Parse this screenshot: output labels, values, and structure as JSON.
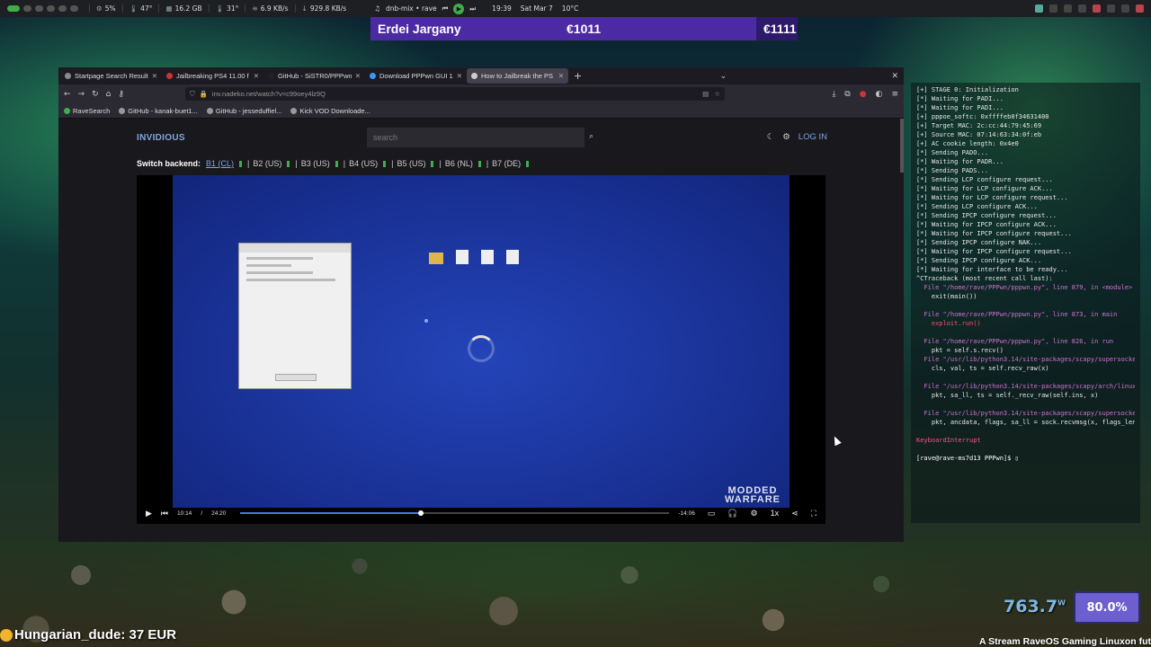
{
  "topbar": {
    "cpu": "5%",
    "temp1": "47°",
    "ram": "16.2 GB",
    "temp2": "31°",
    "net_up": "6.9 KB/s",
    "net_down": "929.8 KB/s",
    "media_title": "dnb-mix • rave",
    "time": "19:39",
    "date": "Sat Mar 7",
    "weather": "10°C"
  },
  "banner": {
    "name": "Erdei Jargany",
    "amount1": "€1011",
    "amount2": "€1111"
  },
  "browser": {
    "tabs": [
      {
        "label": "Startpage Search Result"
      },
      {
        "label": "Jailbreaking PS4 11.00 f"
      },
      {
        "label": "GitHub - SiSTR0/PPPwn"
      },
      {
        "label": "Download PPPwn GUI 1"
      },
      {
        "label": "How to Jailbreak the PS"
      }
    ],
    "url": "inv.nadeko.net/watch?v=c99oey4lz9Q",
    "bookmarks": [
      "RaveSearch",
      "GitHub - kanak-buet1...",
      "GitHub - jesseduffiel...",
      "Kick VOD Downloade..."
    ]
  },
  "invidious": {
    "logo": "INVIDIOUS",
    "search_placeholder": "search",
    "login": "LOG IN",
    "switch_label": "Switch backend:",
    "backends": [
      "B1 (CL)",
      "B2 (US)",
      "B3 (US)",
      "B4 (US)",
      "B5 (US)",
      "B6 (NL)",
      "B7 (DE)"
    ]
  },
  "player": {
    "current_time": "10:14",
    "separator": "/",
    "duration": "24:20",
    "remaining": "-14:06",
    "speed": "1x",
    "progress": 0.42,
    "watermark": "MODDED WARFARE"
  },
  "terminal": {
    "lines": [
      {
        "t": "[+] STAGE 0: Initialization",
        "c": ""
      },
      {
        "t": "[*] Waiting for PADI...",
        "c": ""
      },
      {
        "t": "[*] Waiting for PADI...",
        "c": ""
      },
      {
        "t": "[+] pppoe_softc: 0xffffeb0f34631400",
        "c": ""
      },
      {
        "t": "[+] Target MAC: 2c:cc:44:79:45:69",
        "c": ""
      },
      {
        "t": "[+] Source MAC: 07:14:63:34:0f:eb",
        "c": ""
      },
      {
        "t": "[+] AC cookie length: 0x4e0",
        "c": ""
      },
      {
        "t": "[*] Sending PADO...",
        "c": ""
      },
      {
        "t": "[*] Waiting for PADR...",
        "c": ""
      },
      {
        "t": "[*] Sending PADS...",
        "c": ""
      },
      {
        "t": "[*] Sending LCP configure request...",
        "c": ""
      },
      {
        "t": "[*] Waiting for LCP configure ACK...",
        "c": ""
      },
      {
        "t": "[*] Waiting for LCP configure request...",
        "c": ""
      },
      {
        "t": "[*] Sending LCP configure ACK...",
        "c": ""
      },
      {
        "t": "[*] Sending IPCP configure request...",
        "c": ""
      },
      {
        "t": "[*] Waiting for IPCP configure ACK...",
        "c": ""
      },
      {
        "t": "[*] Waiting for IPCP configure request...",
        "c": ""
      },
      {
        "t": "[*] Sending IPCP configure NAK...",
        "c": ""
      },
      {
        "t": "[*] Waiting for IPCP configure request...",
        "c": ""
      },
      {
        "t": "[*] Sending IPCP configure ACK...",
        "c": ""
      },
      {
        "t": "[*] Waiting for interface to be ready...",
        "c": ""
      },
      {
        "t": "^CTraceback (most recent call last):",
        "c": ""
      },
      {
        "t": "  File \"/home/rave/PPPwn/pppwn.py\", line 879, in <module>",
        "c": "path"
      },
      {
        "t": "    exit(main())",
        "c": ""
      },
      {
        "t": "",
        "c": ""
      },
      {
        "t": "  File \"/home/rave/PPPwn/pppwn.py\", line 873, in main",
        "c": "path"
      },
      {
        "t": "    exploit.run()",
        "c": "hl"
      },
      {
        "t": "",
        "c": ""
      },
      {
        "t": "  File \"/home/rave/PPPwn/pppwn.py\", line 826, in run",
        "c": "path"
      },
      {
        "t": "    pkt = self.s.recv()",
        "c": ""
      },
      {
        "t": "  File \"/usr/lib/python3.14/site-packages/scapy/supersocket.py\", line 285, in recv",
        "c": "path"
      },
      {
        "t": "    cls, val, ts = self.recv_raw(x)",
        "c": ""
      },
      {
        "t": "",
        "c": ""
      },
      {
        "t": "  File \"/usr/lib/python3.14/site-packages/scapy/arch/linux/__init__.py\", line 287, in recv_raw",
        "c": "path"
      },
      {
        "t": "    pkt, sa_ll, ts = self._recv_raw(self.ins, x)",
        "c": ""
      },
      {
        "t": "",
        "c": ""
      },
      {
        "t": "  File \"/usr/lib/python3.14/site-packages/scapy/supersocket.py\", line 147, in _recv_raw",
        "c": "path"
      },
      {
        "t": "    pkt, ancdata, flags, sa_ll = sock.recvmsg(x, flags_len)",
        "c": ""
      },
      {
        "t": "",
        "c": ""
      },
      {
        "t": "KeyboardInterrupt",
        "c": "err"
      }
    ],
    "prompt": "[rave@rave-ms7d13 PPPwn]$ "
  },
  "overlay": {
    "donation": "Hungarian_dude: 37 EUR",
    "power": "763.7",
    "power_unit": "W",
    "percent": "80.0%",
    "ticker": "A Stream RaveOS Gaming Linuxon fut"
  },
  "colors": {
    "accent_green": "#3fae4a",
    "banner_purple": "#4b2aa4",
    "invidious_blue": "#7ea6dd",
    "video_blue": "#1a3399"
  }
}
